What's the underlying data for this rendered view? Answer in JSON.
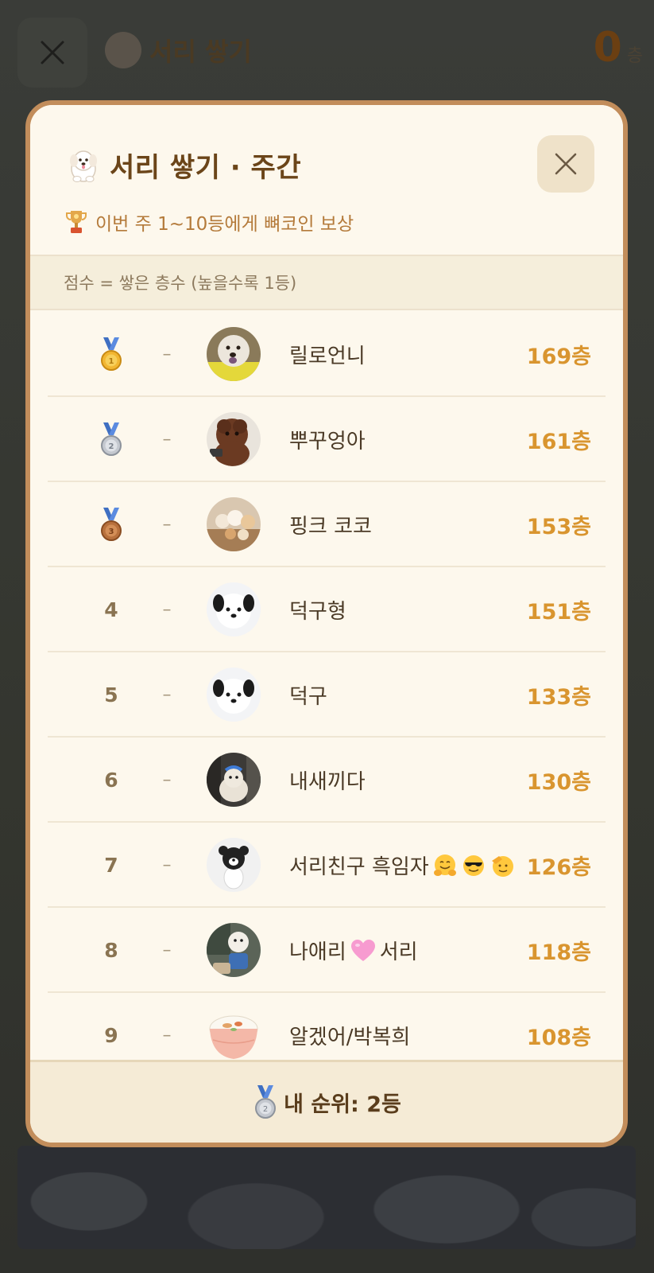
{
  "background": {
    "title": "서리 쌓기",
    "score_value": "0",
    "score_unit": "층"
  },
  "modal": {
    "title": "서리 쌓기 · 주간",
    "reward_text": "이번 주 1~10등에게 뼈코인 보상",
    "score_rule": "점수 = 쌓은 층수 (높을수록 1등)",
    "footer_text": "내 순위: 2등"
  },
  "leaderboard": [
    {
      "rank": "1",
      "medal": "gold",
      "change": "–",
      "name": "릴로언니",
      "score": "169층",
      "avatar": "white-dog-tongue"
    },
    {
      "rank": "2",
      "medal": "silver",
      "change": "–",
      "name": "뿌꾸엉아",
      "score": "161층",
      "avatar": "brown-poodle"
    },
    {
      "rank": "3",
      "medal": "bronze",
      "change": "–",
      "name": "핑크 코코",
      "score": "153층",
      "avatar": "dogs-group"
    },
    {
      "rank": "4",
      "medal": "",
      "change": "–",
      "name": "덕구형",
      "score": "151층",
      "avatar": "panda-dog"
    },
    {
      "rank": "5",
      "medal": "",
      "change": "–",
      "name": "덕구",
      "score": "133층",
      "avatar": "panda-dog"
    },
    {
      "rank": "6",
      "medal": "",
      "change": "–",
      "name": "내새끼다",
      "score": "130층",
      "avatar": "dog-blue-bow"
    },
    {
      "rank": "7",
      "medal": "",
      "change": "–",
      "name": "서리친구 흑임자",
      "emojis": [
        "hugging-face",
        "sunglasses-face",
        "saluting-face"
      ],
      "score": "126층",
      "avatar": "black-white-dog"
    },
    {
      "rank": "8",
      "medal": "",
      "change": "–",
      "name_a": "나애리",
      "name_b": "서리",
      "score": "118층",
      "avatar": "dog-toy"
    },
    {
      "rank": "9",
      "medal": "",
      "change": "–",
      "name": "알겠어/박복희",
      "score": "108층",
      "avatar": "rice-bowl"
    }
  ],
  "colors": {
    "accent": "#d9952f",
    "title": "#6b4519",
    "border": "#c28d5b"
  }
}
